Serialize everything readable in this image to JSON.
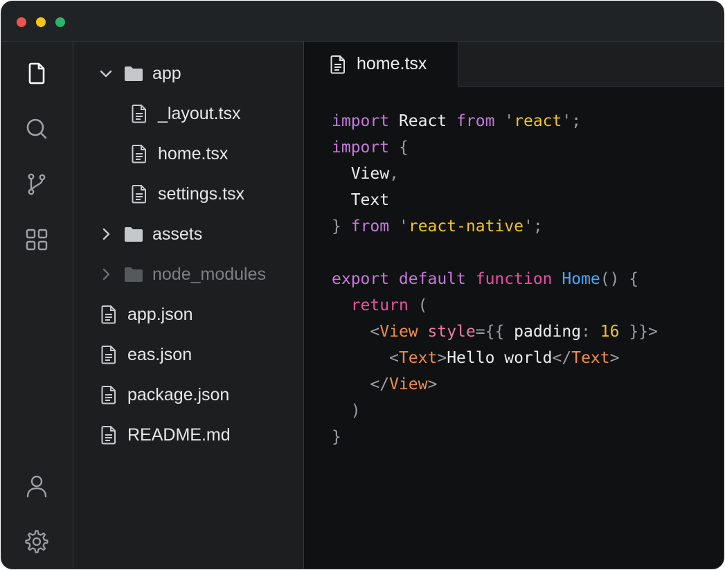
{
  "window": {
    "controls": [
      "close",
      "minimize",
      "maximize"
    ],
    "colors": {
      "close": "#ef5350",
      "minimize": "#f5c518",
      "maximize": "#2fb36a"
    }
  },
  "activity_bar": {
    "top_icons": [
      "file-icon",
      "search-icon",
      "source-control-icon",
      "extensions-icon"
    ],
    "bottom_icons": [
      "account-icon",
      "settings-icon"
    ]
  },
  "explorer": {
    "items": [
      {
        "label": "app",
        "type": "folder",
        "expanded": true,
        "level": 0
      },
      {
        "label": "_layout.tsx",
        "type": "file",
        "level": 1
      },
      {
        "label": "home.tsx",
        "type": "file",
        "level": 1
      },
      {
        "label": "settings.tsx",
        "type": "file",
        "level": 1
      },
      {
        "label": "assets",
        "type": "folder",
        "expanded": false,
        "level": 0
      },
      {
        "label": "node_modules",
        "type": "folder",
        "expanded": false,
        "level": 0,
        "dimmed": true
      },
      {
        "label": "app.json",
        "type": "file",
        "level": 0
      },
      {
        "label": "eas.json",
        "type": "file",
        "level": 0
      },
      {
        "label": "package.json",
        "type": "file",
        "level": 0
      },
      {
        "label": "README.md",
        "type": "file",
        "level": 0
      }
    ]
  },
  "editor": {
    "active_tab": "home.tsx",
    "code_lines": [
      [
        [
          "kw",
          "import"
        ],
        [
          "txt",
          " React "
        ],
        [
          "kw",
          "from"
        ],
        [
          "txt",
          " "
        ],
        [
          "pun",
          "'"
        ],
        [
          "str",
          "react"
        ],
        [
          "pun",
          "';"
        ]
      ],
      [
        [
          "kw",
          "import"
        ],
        [
          "txt",
          " "
        ],
        [
          "pun",
          "{"
        ]
      ],
      [
        [
          "txt",
          "  View"
        ],
        [
          "pun",
          ","
        ]
      ],
      [
        [
          "txt",
          "  Text"
        ]
      ],
      [
        [
          "pun",
          "}"
        ],
        [
          "txt",
          " "
        ],
        [
          "kw",
          "from"
        ],
        [
          "txt",
          " "
        ],
        [
          "pun",
          "'"
        ],
        [
          "str",
          "react-native"
        ],
        [
          "pun",
          "';"
        ]
      ],
      [],
      [
        [
          "kw",
          "export default"
        ],
        [
          "txt",
          " "
        ],
        [
          "kw2",
          "function"
        ],
        [
          "txt",
          " "
        ],
        [
          "fn",
          "Home"
        ],
        [
          "pun",
          "() {"
        ]
      ],
      [
        [
          "txt",
          "  "
        ],
        [
          "kw2",
          "return"
        ],
        [
          "txt",
          " "
        ],
        [
          "pun",
          "("
        ]
      ],
      [
        [
          "txt",
          "    "
        ],
        [
          "pun",
          "<"
        ],
        [
          "tag",
          "View"
        ],
        [
          "txt",
          " "
        ],
        [
          "attr",
          "style"
        ],
        [
          "pun",
          "={{"
        ],
        [
          "txt",
          " padding"
        ],
        [
          "pun",
          ":"
        ],
        [
          "txt",
          " "
        ],
        [
          "num",
          "16"
        ],
        [
          "txt",
          " "
        ],
        [
          "pun",
          "}}>"
        ]
      ],
      [
        [
          "txt",
          "      "
        ],
        [
          "pun",
          "<"
        ],
        [
          "tag",
          "Text"
        ],
        [
          "pun",
          ">"
        ],
        [
          "txt",
          "Hello world"
        ],
        [
          "pun",
          "</"
        ],
        [
          "tag",
          "Text"
        ],
        [
          "pun",
          ">"
        ]
      ],
      [
        [
          "txt",
          "    "
        ],
        [
          "pun",
          "</"
        ],
        [
          "tag",
          "View"
        ],
        [
          "pun",
          ">"
        ]
      ],
      [
        [
          "txt",
          "  "
        ],
        [
          "pun",
          ")"
        ]
      ],
      [
        [
          "pun",
          "}"
        ]
      ]
    ],
    "colors": {
      "keyword": "#c678dd",
      "keyword_alt": "#ec4fa3",
      "string": "#f5c518",
      "function": "#4aa8ff",
      "tag": "#f08d49",
      "attribute": "#f07aa0",
      "punctuation": "#9a9ea3",
      "text": "#eceef0"
    }
  }
}
